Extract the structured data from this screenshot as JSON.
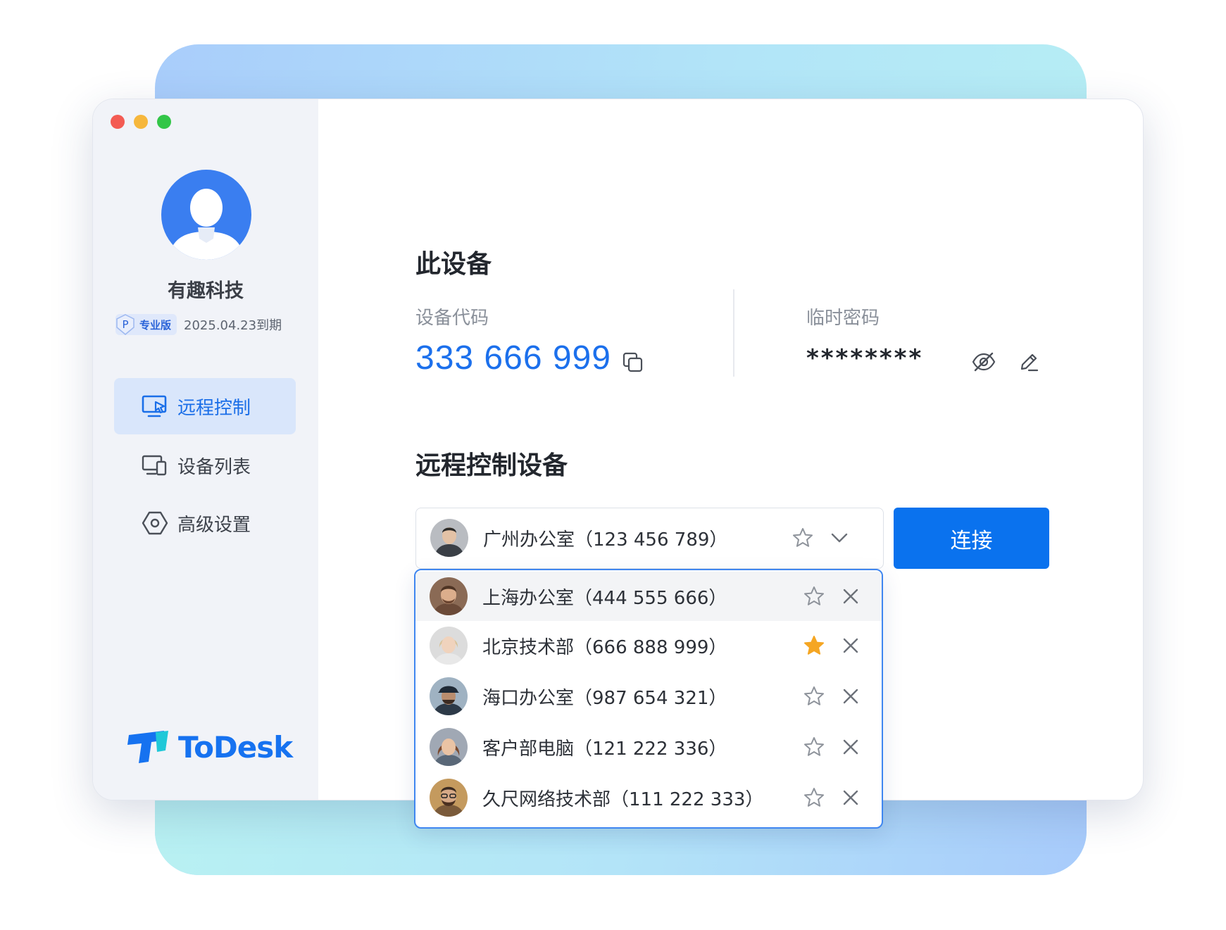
{
  "app": {
    "brand_name": "ToDesk",
    "colors": {
      "accent": "#0a72ee",
      "sidebar_bg": "#f1f3f8",
      "active_nav_bg": "#d9e6fb",
      "star_active": "#f5a623"
    }
  },
  "sidebar": {
    "user_name": "有趣科技",
    "plan": {
      "badge_letter": "P",
      "label": "专业版",
      "expiry": "2025.04.23到期"
    },
    "nav": [
      {
        "label": "远程控制",
        "icon": "monitor-cursor-icon",
        "active": true
      },
      {
        "label": "设备列表",
        "icon": "devices-icon",
        "active": false
      },
      {
        "label": "高级设置",
        "icon": "hexagon-settings-icon",
        "active": false
      }
    ]
  },
  "this_device": {
    "title": "此设备",
    "code_label": "设备代码",
    "code": "333 666 999",
    "password_label": "临时密码",
    "password": "********"
  },
  "remote": {
    "title": "远程控制设备",
    "selected": {
      "name": "广州办公室（123 456 789）",
      "favorite": false
    },
    "connect_label": "连接",
    "history": [
      {
        "name": "上海办公室（444 555 666）",
        "favorite": false
      },
      {
        "name": "北京技术部（666 888 999）",
        "favorite": true
      },
      {
        "name": "海口办公室（987 654 321）",
        "favorite": false
      },
      {
        "name": "客户部电脑（121 222 336）",
        "favorite": false
      },
      {
        "name": "久尺网络技术部（111 222 333）",
        "favorite": false
      }
    ]
  }
}
